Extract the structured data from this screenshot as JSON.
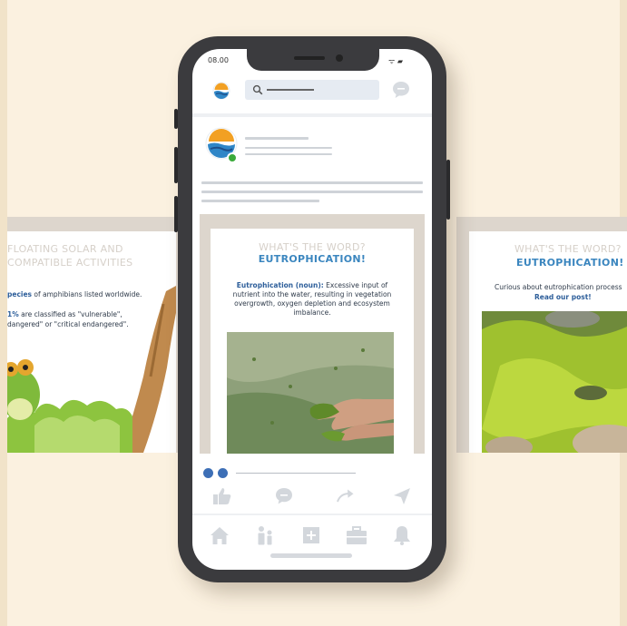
{
  "status_bar": {
    "time": "08.00",
    "icons": "ᯤ ▰"
  },
  "left_card": {
    "title_line1": "FLOATING SOLAR AND",
    "title_line2": "COMPATIBLE ACTIVITIES",
    "species_bold": "pecies",
    "species_rest": " of amphibians listed worldwide.",
    "percent_bold": "1%",
    "percent_rest": " are classified as \"vulnerable\",",
    "line3": "dangered\" or \"critical endangered\"."
  },
  "post": {
    "title_line1": "WHAT'S THE WORD?",
    "title_line2": "EUTROPHICATION!",
    "term": "Eutrophication (noun):",
    "definition": " Excessive input of nutrient into the water, resulting in vegetation overgrowth, oxygen depletion and ecosystem imbalance."
  },
  "right_card": {
    "title_line1": "WHAT'S THE WORD?",
    "title_line2": "EUTROPHICATION!",
    "line1": "Curious about eutrophication process",
    "line2": "Read our post!"
  },
  "colors": {
    "accent_blue": "#3b86bf",
    "dark_blue": "#2d5e9a",
    "online_green": "#3aaa3a",
    "background": "#fbf1e0",
    "frame_tan": "#ddd6cd"
  },
  "icons": {
    "top": [
      "logo-icon",
      "search-icon",
      "chat-icon"
    ],
    "actions": [
      "like-icon",
      "comment-icon",
      "share-icon",
      "send-icon"
    ],
    "nav": [
      "home-icon",
      "people-icon",
      "add-icon",
      "briefcase-icon",
      "bell-icon"
    ]
  }
}
